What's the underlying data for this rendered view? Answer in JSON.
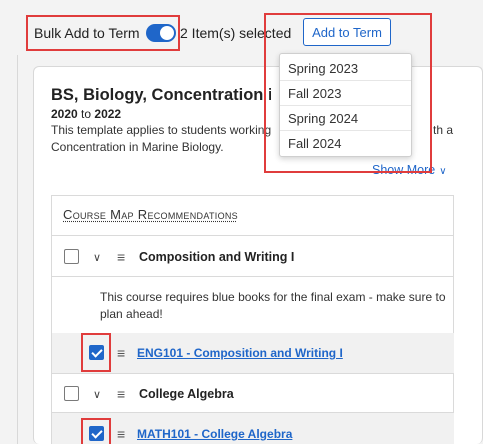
{
  "toolbar": {
    "bulk_label": "Bulk Add to Term",
    "bulk_enabled": true,
    "selected_count": "2 Item(s) selected",
    "add_to_term_label": "Add to Term",
    "term_options": [
      "Spring 2023",
      "Fall 2023",
      "Spring 2024",
      "Fall 2024"
    ]
  },
  "template": {
    "title": "BS, Biology, Concentration in Marine Biology",
    "year_start": "2020",
    "year_to": "to",
    "year_end": "2022",
    "description_part1": "This template applies to students working",
    "description_part1_tail": "th a",
    "description_part2": "Concentration in Marine Biology.",
    "show_more": "Show More"
  },
  "recommendations": {
    "header": "Course Map Recommendations",
    "groups": [
      {
        "title": "Composition and Writing I",
        "note": "This course requires blue books for the final exam - make sure to plan ahead!",
        "course": "ENG101 - Composition and Writing I",
        "course_checked": true
      },
      {
        "title": "College Algebra",
        "course": "MATH101 - College Algebra",
        "course_checked": true
      }
    ]
  },
  "colors": {
    "accent": "#1f66c9",
    "highlight": "#e03c3c"
  }
}
